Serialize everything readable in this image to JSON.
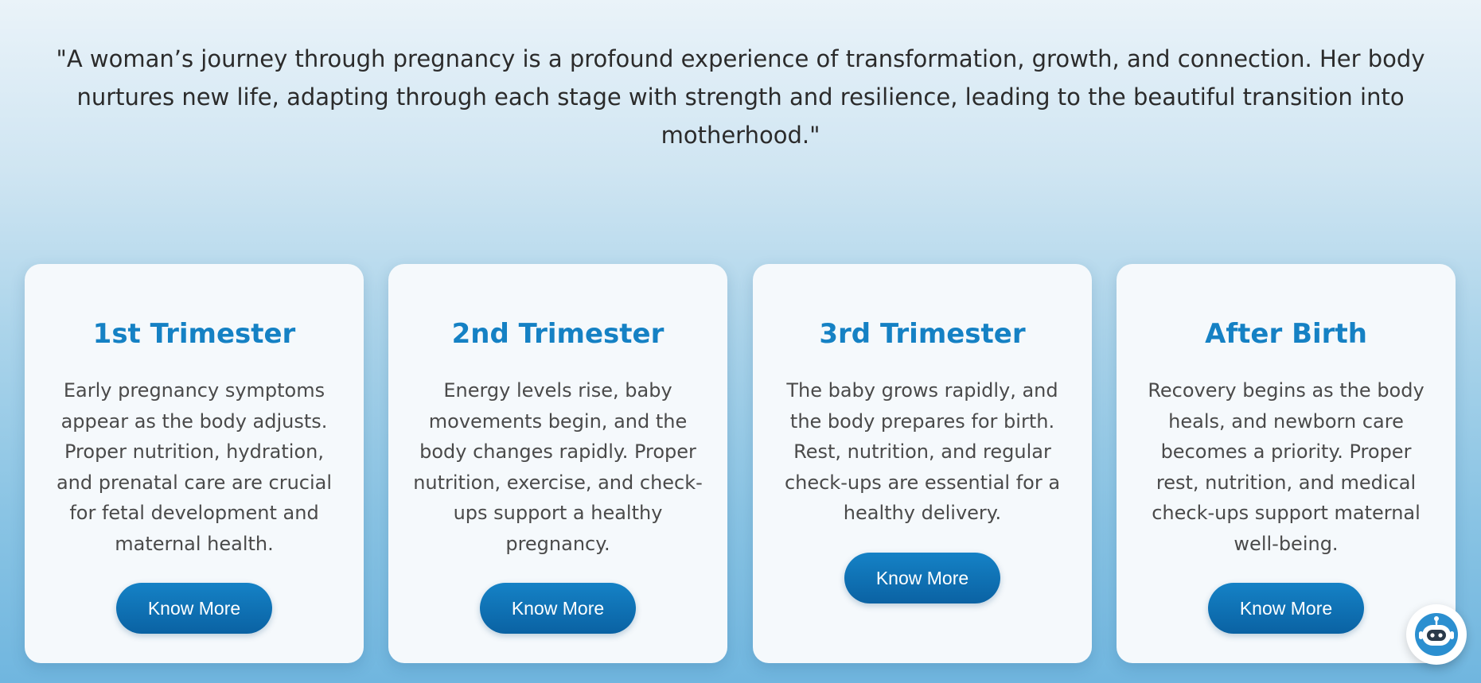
{
  "quote": {
    "text": "\"A woman’s journey through pregnancy is a profound experience of transformation, growth, and connection. Her body nurtures new life, adapting through each stage with strength and resilience, leading to the beautiful transition into motherhood.\""
  },
  "cards": [
    {
      "title": "1st Trimester",
      "text": "Early pregnancy symptoms appear as the body adjusts. Proper nutrition, hydration, and prenatal care are crucial for fetal development and maternal health.",
      "button": "Know More"
    },
    {
      "title": "2nd Trimester",
      "text": "Energy levels rise, baby movements begin, and the body changes rapidly. Proper nutrition, exercise, and check-ups support a healthy pregnancy.",
      "button": "Know More"
    },
    {
      "title": "3rd Trimester",
      "text": "The baby grows rapidly, and the body prepares for birth. Rest, nutrition, and regular check-ups are essential for a healthy delivery.",
      "button": "Know More"
    },
    {
      "title": "After Birth",
      "text": "Recovery begins as the body heals, and newborn care becomes a priority. Proper rest, nutrition, and medical check-ups support maternal well-being.",
      "button": "Know More"
    }
  ],
  "chat_widget": {
    "icon": "chatbot-icon",
    "accent": "#2b8fd0"
  },
  "colors": {
    "accent": "#1581c4",
    "button": "#0a62a3",
    "card_bg": "#f5f9fc"
  }
}
